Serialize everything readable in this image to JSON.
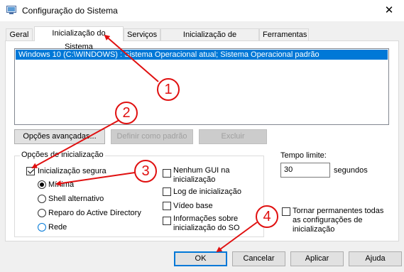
{
  "window": {
    "title": "Configuração do Sistema",
    "close_glyph": "✕",
    "icon": "system-config-icon"
  },
  "tabs": [
    {
      "label": "Geral",
      "selected": false
    },
    {
      "label": "Inicialização do Sistema",
      "selected": true
    },
    {
      "label": "Serviços",
      "selected": false
    },
    {
      "label": "Inicialização de Programas",
      "selected": false
    },
    {
      "label": "Ferramentas",
      "selected": false
    }
  ],
  "boot_list": {
    "entries": [
      "Windows 10 (C:\\WINDOWS) : Sistema Operacional atual; Sistema Operacional padrão"
    ],
    "selected_color": "#0078d7"
  },
  "boot_buttons": {
    "advanced": "Opções avançadas...",
    "set_default": "Definir como padrão",
    "delete": "Excluir"
  },
  "boot_options": {
    "group_label": "Opções de inicialização",
    "safe_boot": {
      "label": "Inicialização segura",
      "checked": true
    },
    "radios": [
      {
        "label": "Mínima",
        "checked": true
      },
      {
        "label": "Shell alternativo",
        "checked": false
      },
      {
        "label": "Reparo do Active Directory",
        "checked": false
      },
      {
        "label": "Rede",
        "checked": false
      }
    ],
    "right_checks": [
      {
        "label1": "Nenhum GUI na",
        "label2": "inicialização",
        "checked": false
      },
      {
        "label1": "Log de inicialização",
        "label2": "",
        "checked": false
      },
      {
        "label1": "Vídeo base",
        "label2": "",
        "checked": false
      },
      {
        "label1": "Informações sobre",
        "label2": "inicialização do SO",
        "checked": false
      }
    ]
  },
  "timeout": {
    "label": "Tempo limite:",
    "value": "30",
    "unit": "segundos"
  },
  "permanent": {
    "line1": "Tornar permanentes todas",
    "line2": "as configurações de",
    "line3": "inicialização",
    "checked": false
  },
  "footer": {
    "ok": "OK",
    "cancel": "Cancelar",
    "apply": "Aplicar",
    "help": "Ajuda"
  },
  "callouts": [
    "1",
    "2",
    "3",
    "4"
  ],
  "annotation_color": "#e01010"
}
